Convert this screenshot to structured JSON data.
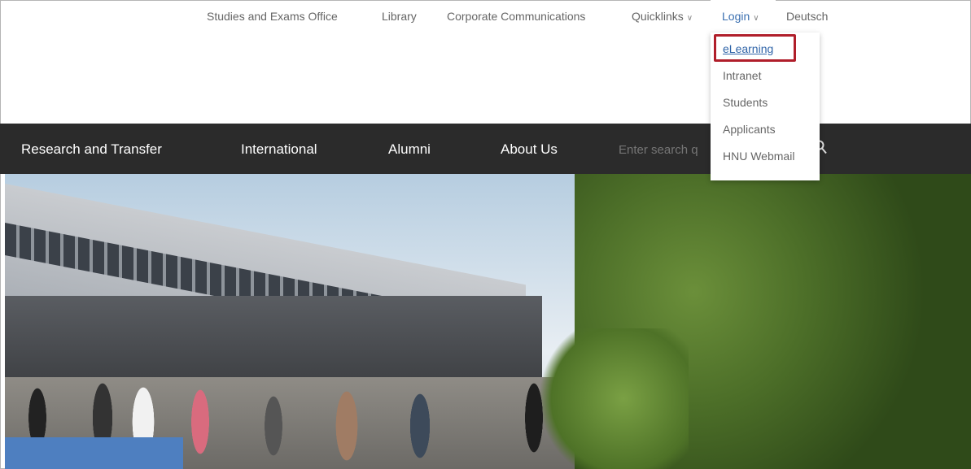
{
  "topbar": {
    "links": [
      {
        "label": "Studies and Exams Office"
      },
      {
        "label": "Library"
      },
      {
        "label": "Corporate Communications"
      },
      {
        "label": "Quicklinks",
        "icon": "chevron-down-icon"
      },
      {
        "label": "Login",
        "icon": "chevron-down-icon"
      },
      {
        "label": "Deutsch"
      }
    ]
  },
  "login_menu": {
    "items": [
      "eLearning",
      "Intranet",
      "Students",
      "Applicants",
      "HNU Webmail"
    ],
    "highlighted": "eLearning"
  },
  "mainnav": {
    "items": [
      "Research and Transfer",
      "International",
      "Alumni",
      "About Us"
    ],
    "search_placeholder": "Enter search q",
    "search_icon": "search-icon"
  },
  "colors": {
    "nav_bg": "#2b2b2b",
    "link_blue": "#2f64a8",
    "highlight_red": "#b01e2a",
    "accent_blue": "#4e7fc0"
  }
}
